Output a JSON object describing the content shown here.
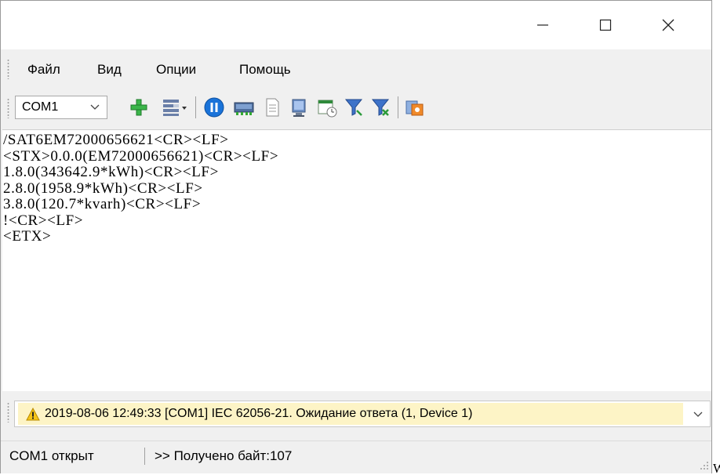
{
  "menu": {
    "file": "Файл",
    "view": "Вид",
    "options": "Опции",
    "help": "Помощь"
  },
  "toolbar": {
    "port_select": "COM1",
    "icons": [
      "add-icon",
      "list-menu-icon",
      "pause-icon",
      "device-icon",
      "document-icon",
      "computer-icon",
      "calendar-icon",
      "satellite-filter-icon",
      "satellite-remove-icon",
      "export-icon"
    ]
  },
  "terminal": {
    "lines": [
      "/SAT6EM72000656621<CR><LF>",
      "<STX>0.0.0(EM72000656621)<CR><LF>",
      "1.8.0(343642.9*kWh)<CR><LF>",
      "2.8.0(1958.9*kWh)<CR><LF>",
      "3.8.0(120.7*kvarh)<CR><LF>",
      "!<CR><LF>",
      "<ETX>"
    ]
  },
  "log": {
    "message": "2019-08-06 12:49:33 [COM1] IEC 62056-21. Ожидание ответа (1, Device 1)",
    "highlight_color": "#fdf4c6",
    "icon": "warning-icon"
  },
  "status": {
    "port_state": "COM1 открыт",
    "received": ">> Получено байт:107"
  },
  "edge_text": "W"
}
